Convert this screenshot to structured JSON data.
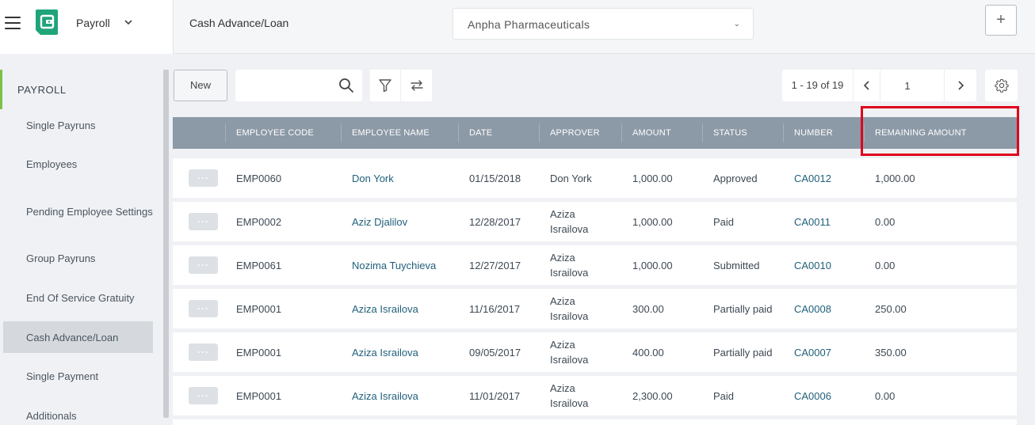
{
  "header": {
    "module": "Payroll",
    "page": "Cash Advance/Loan",
    "company": "Anpha Pharmaceuticals",
    "plus_label": "+"
  },
  "sidebar": {
    "section": "PAYROLL",
    "items": [
      {
        "label": "Single Payruns",
        "active": false
      },
      {
        "label": "Employees",
        "active": false
      },
      {
        "label": "Pending Employee Settings",
        "active": false
      },
      {
        "label": "Group Payruns",
        "active": false
      },
      {
        "label": "End Of Service Gratuity",
        "active": false
      },
      {
        "label": "Cash Advance/Loan",
        "active": true
      },
      {
        "label": "Single Payment",
        "active": false
      },
      {
        "label": "Additionals",
        "active": false
      }
    ]
  },
  "toolbar": {
    "new_label": "New",
    "search_value": "",
    "pager_range": "1 - 19 of 19",
    "pager_page": "1"
  },
  "table": {
    "columns": [
      "EMPLOYEE CODE",
      "EMPLOYEE NAME",
      "DATE",
      "APPROVER",
      "AMOUNT",
      "STATUS",
      "NUMBER",
      "REMAINING AMOUNT"
    ],
    "rows": [
      {
        "code": "EMP0060",
        "name": "Don York",
        "date": "01/15/2018",
        "approver": "Don York",
        "amount": "1,000.00",
        "status": "Approved",
        "number": "CA0012",
        "remaining": "1,000.00"
      },
      {
        "code": "EMP0002",
        "name": "Aziz Djalilov",
        "date": "12/28/2017",
        "approver": "Aziza Israilova",
        "amount": "1,000.00",
        "status": "Paid",
        "number": "CA0011",
        "remaining": "0.00"
      },
      {
        "code": "EMP0061",
        "name": "Nozima Tuychieva",
        "date": "12/27/2017",
        "approver": "Aziza Israilova",
        "amount": "1,000.00",
        "status": "Submitted",
        "number": "CA0010",
        "remaining": "0.00"
      },
      {
        "code": "EMP0001",
        "name": "Aziza Israilova",
        "date": "11/16/2017",
        "approver": "Aziza Israilova",
        "amount": "300.00",
        "status": "Partially paid",
        "number": "CA0008",
        "remaining": "250.00"
      },
      {
        "code": "EMP0001",
        "name": "Aziza Israilova",
        "date": "09/05/2017",
        "approver": "Aziza Israilova",
        "amount": "400.00",
        "status": "Partially paid",
        "number": "CA0007",
        "remaining": "350.00"
      },
      {
        "code": "EMP0001",
        "name": "Aziza Israilova",
        "date": "11/01/2017",
        "approver": "Aziza Israilova",
        "amount": "2,300.00",
        "status": "Paid",
        "number": "CA0006",
        "remaining": "0.00"
      }
    ]
  },
  "colors": {
    "brand": "#1fa37a",
    "accent_bar": "#7cc24a",
    "header_bg": "#8c99a6",
    "link": "#1f5f7a",
    "highlight": "#e0001b"
  },
  "icons": {
    "menu": "hamburger-icon",
    "logo": "payroll-logo-icon",
    "search": "search-icon",
    "filter": "filter-icon",
    "refresh": "swap-icon",
    "settings": "gear-icon"
  }
}
